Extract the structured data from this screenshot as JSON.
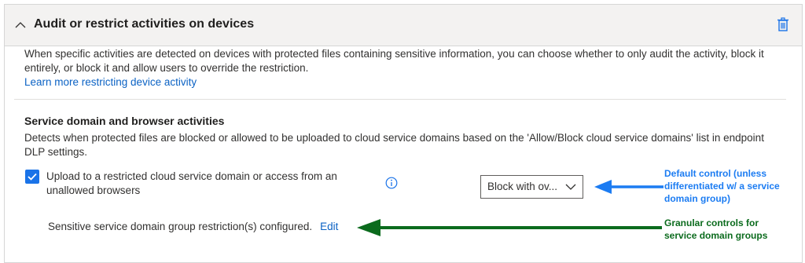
{
  "header": {
    "title": "Audit or restrict activities on devices"
  },
  "intro": {
    "text": "When specific activities are detected on devices with protected files containing sensitive information, you can choose whether to only audit the activity, block it entirely, or block it and allow users to override the restriction.",
    "link": "Learn more restricting device activity"
  },
  "section": {
    "title": "Service domain and browser activities",
    "description": "Detects when protected files are blocked or allowed to be uploaded to cloud service domains based on the 'Allow/Block cloud service domains' list in endpoint DLP settings.",
    "checkbox_label": "Upload to a restricted cloud service domain or access from an unallowed browsers",
    "checkbox_checked": true,
    "dropdown_value": "Block with ov...",
    "group_text": "Sensitive service domain group restriction(s) configured.",
    "edit_label": "Edit"
  },
  "annotations": {
    "default_control": "Default control (unless differentiated w/ a service domain group)",
    "granular_controls": "Granular controls for service domain groups"
  },
  "colors": {
    "accent": "#1a73e8",
    "link": "#0b62c4",
    "annotation_blue": "#1c7cf2",
    "annotation_green": "#0b6b1d"
  },
  "icons": {
    "collapse": "chevron-up-icon",
    "delete": "trash-icon",
    "info": "info-icon",
    "checkbox": "checkmark-icon",
    "dropdown": "chevron-down-icon"
  }
}
